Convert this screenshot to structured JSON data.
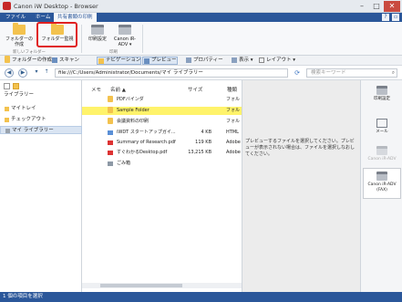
{
  "window": {
    "title": "Canon iW Desktop - Browser"
  },
  "ribbon_tabs": [
    "ファイル",
    "ホーム",
    "共有書類の印刷"
  ],
  "ribbon": {
    "folder_create": "フォルダーの作成",
    "folder_watch": "フォルダー監視",
    "new_group": "新しいフォルダー",
    "print_settings": "印刷設定",
    "canon_device": "Canon iR-ADV ▾",
    "print_group": "印刷"
  },
  "toolbar": {
    "create_folder": "フォルダーの作成",
    "scan": "スキャン",
    "navigation": "ナビゲーション",
    "preview": "プレビュー",
    "property": "プロパティー",
    "view": "表示 ▾",
    "layout": "レイアウト ▾"
  },
  "address": {
    "path": "file:///C:/Users/Administrator/Documents/マイ ライブラリー",
    "search_placeholder": "検索キーワード"
  },
  "left_panel": {
    "title": "ライブラリー",
    "items": [
      "マイトレイ",
      "チェックアウト",
      "マイ ライブラリー"
    ]
  },
  "columns": {
    "memo": "メモ",
    "name": "名前 ▲",
    "size": "サイズ",
    "type": "種類"
  },
  "files": [
    {
      "name": "PDFバインダ",
      "size": "",
      "type": "フォル"
    },
    {
      "name": "Sample Folder",
      "size": "",
      "type": "フォル"
    },
    {
      "name": "会議資料の印刷",
      "size": "",
      "type": "フォル"
    },
    {
      "name": "iWDT スタートアップガイ...",
      "size": "4 KB",
      "type": "HTML"
    },
    {
      "name": "Summary of Research.pdf",
      "size": "119 KB",
      "type": "Adobe"
    },
    {
      "name": "すぐわかるDesktop.pdf",
      "size": "13,215 KB",
      "type": "Adobe"
    },
    {
      "name": "ごみ箱",
      "size": "",
      "type": ""
    }
  ],
  "preview": {
    "message": "プレビューするファイルを選択してください。プレビューが表示されない場合は、ファイルを選択しなおしてください。"
  },
  "right_bar": [
    "印刷設定",
    "メール",
    "Canon iR-ADV",
    "Canon iR-ADV (FAX)"
  ],
  "status": "1 個の項目を選択"
}
